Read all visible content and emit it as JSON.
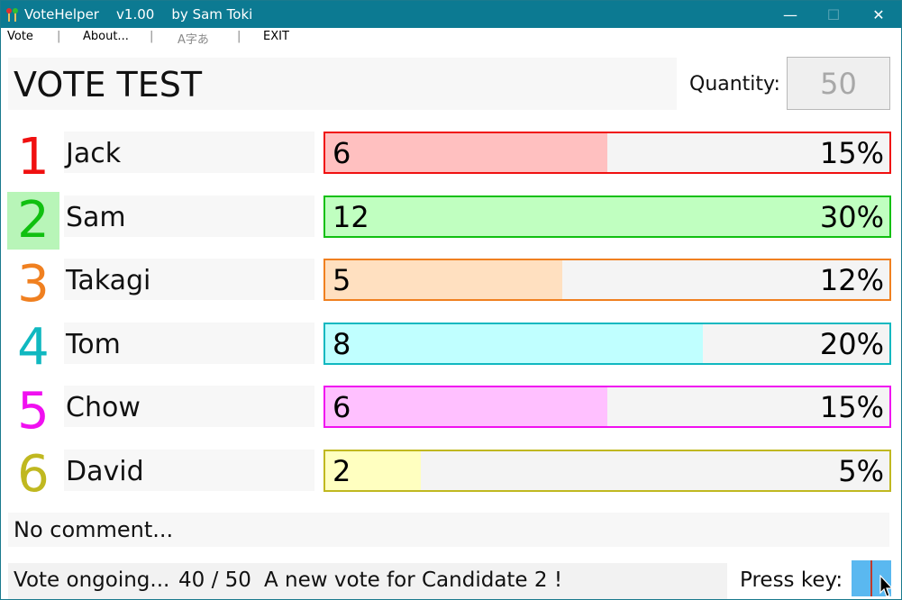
{
  "window": {
    "title": "VoteHelper    v1.00    by Sam Toki",
    "minimize_glyph": "—",
    "maximize_glyph": "☐",
    "close_glyph": "✕"
  },
  "menu": {
    "items": [
      {
        "label": "Vote"
      },
      {
        "label": "About..."
      },
      {
        "label": "A字あ"
      },
      {
        "label": "EXIT"
      }
    ],
    "separator": "|"
  },
  "header": {
    "title": "VOTE TEST",
    "quantity_label": "Quantity:",
    "quantity_value": "50"
  },
  "candidates": [
    {
      "num": "1",
      "name": "Jack",
      "count": "6",
      "percent": "15%",
      "fill": 0.5,
      "color": "#f01010",
      "fill_color": "#ffc0c0"
    },
    {
      "num": "2",
      "name": "Sam",
      "count": "12",
      "percent": "30%",
      "fill": 1.0,
      "color": "#10c010",
      "fill_color": "#c0ffc0",
      "highlight": true
    },
    {
      "num": "3",
      "name": "Takagi",
      "count": "5",
      "percent": "12%",
      "fill": 0.42,
      "color": "#f08020",
      "fill_color": "#ffe0c0"
    },
    {
      "num": "4",
      "name": "Tom",
      "count": "8",
      "percent": "20%",
      "fill": 0.67,
      "color": "#10b8c0",
      "fill_color": "#c0ffff"
    },
    {
      "num": "5",
      "name": "Chow",
      "count": "6",
      "percent": "15%",
      "fill": 0.5,
      "color": "#f010f0",
      "fill_color": "#ffc0ff"
    },
    {
      "num": "6",
      "name": "David",
      "count": "2",
      "percent": "5%",
      "fill": 0.17,
      "color": "#c0b820",
      "fill_color": "#ffffc0"
    }
  ],
  "comment": "No comment...",
  "status": {
    "state": "Vote ongoing...",
    "progress": "40 / 50",
    "message": "A new vote for Candidate 2 !",
    "press_key_label": "Press key:"
  }
}
